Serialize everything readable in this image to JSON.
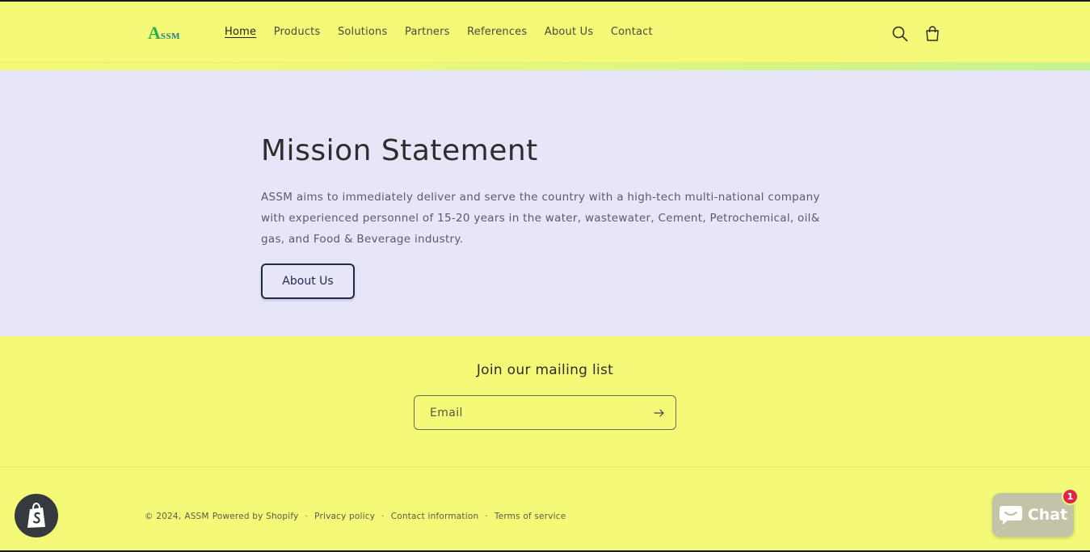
{
  "header": {
    "logo": {
      "first_letter": "A",
      "rest": "SSM"
    },
    "nav": [
      {
        "label": "Home",
        "active": true
      },
      {
        "label": "Products",
        "active": false
      },
      {
        "label": "Solutions",
        "active": false
      },
      {
        "label": "Partners",
        "active": false
      },
      {
        "label": "References",
        "active": false
      },
      {
        "label": "About Us",
        "active": false
      },
      {
        "label": "Contact",
        "active": false
      }
    ],
    "icons": {
      "search": "search-icon",
      "cart": "cart-icon"
    }
  },
  "mission": {
    "title": "Mission Statement",
    "body": "ASSM aims to immediately deliver and serve the country with a high-tech multi-national company with experienced personnel of 15-20 years in the water, wastewater, Cement, Petrochemical, oil& gas, and Food & Beverage industry.",
    "button_label": "About Us"
  },
  "newsletter": {
    "title": "Join our mailing list",
    "email_placeholder": "Email",
    "submit_icon": "arrow-right-icon"
  },
  "footer": {
    "copyright": "© 2024,",
    "brand": "ASSM",
    "powered_by": "Powered by Shopify",
    "separator": "·",
    "links": [
      "Privacy policy",
      "Contact information",
      "Terms of service"
    ]
  },
  "chat": {
    "label": "Chat",
    "badge_count": "1"
  },
  "colors": {
    "page_bg": "#f4fa78",
    "mission_bg": "#e7e6f9",
    "accent_dark": "#1f2a4a",
    "chat_bg": "#c2c3a7",
    "badge_red": "#e0244c",
    "shopify_badge": "#343a3e"
  }
}
